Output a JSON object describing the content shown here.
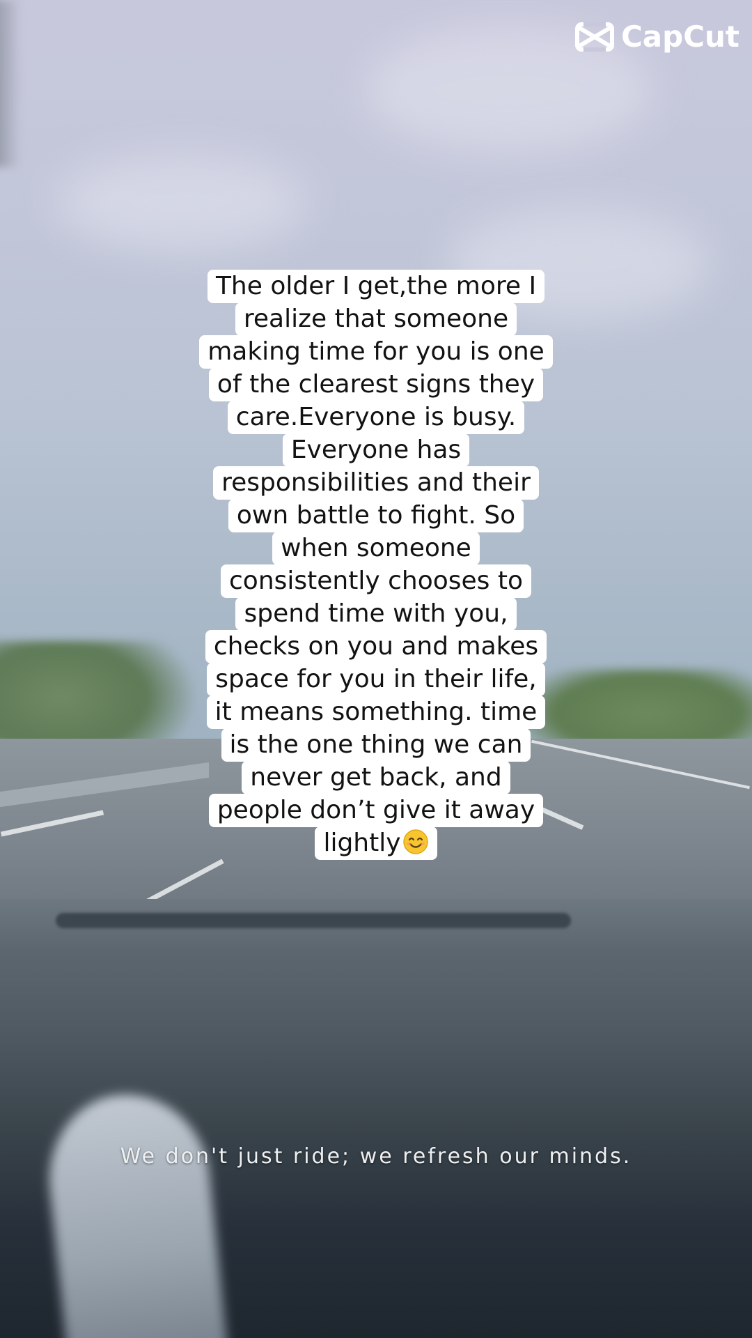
{
  "brand": {
    "name": "CapCut",
    "icon": "capcut-logo-icon"
  },
  "caption": {
    "lines": [
      "The older I get,the more I",
      "realize that someone",
      "making time for you is one",
      "of the clearest signs they",
      "care.Everyone is busy.",
      "Everyone has",
      "responsibilities and their",
      "own battle to fight. So",
      "when someone",
      "consistently chooses to",
      "spend time with you,",
      "checks on you and makes",
      "space for you in their life,",
      "it means something. time",
      "is the one thing we can",
      "never get back, and",
      "people don’t give it away",
      "lightly"
    ],
    "emoji": "smiling-face-emoji"
  },
  "subtitle": "We don't just ride; we refresh our minds.",
  "colors": {
    "caption_bg": "#ffffff",
    "caption_text": "#121212",
    "subtitle_text": "#eef0f2"
  }
}
